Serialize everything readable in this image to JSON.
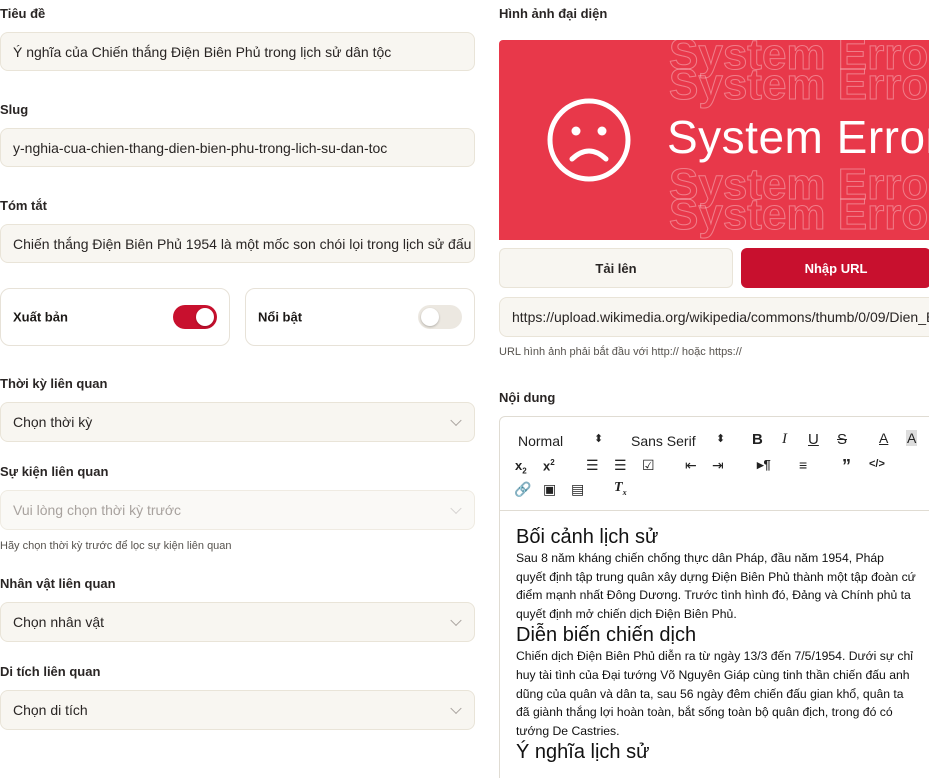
{
  "form": {
    "title_label": "Tiêu đề",
    "title_value": "Ý nghĩa của Chiến thắng Điện Biên Phủ trong lịch sử dân tộc",
    "slug_label": "Slug",
    "slug_value": "y-nghia-cua-chien-thang-dien-bien-phu-trong-lich-su-dan-toc",
    "summary_label": "Tóm tắt",
    "summary_value": "Chiến thắng Điện Biên Phủ 1954 là một mốc son chói lọi trong lịch sử đấu tranh",
    "publish_label": "Xuất bản",
    "publish_on": true,
    "featured_label": "Nổi bật",
    "featured_on": false,
    "period_label": "Thời kỳ liên quan",
    "period_placeholder": "Chọn thời kỳ",
    "event_label": "Sự kiện liên quan",
    "event_placeholder": "Vui lòng chọn thời kỳ trước",
    "event_hint": "Hãy chọn thời kỳ trước để lọc sự kiện liên quan",
    "person_label": "Nhân vật liên quan",
    "person_placeholder": "Chọn nhân vật",
    "relic_label": "Di tích liên quan",
    "relic_placeholder": "Chọn di tích"
  },
  "image": {
    "label": "Hình ảnh đại diện",
    "preview_text": "System Error",
    "upload_label": "Tải lên",
    "url_label": "Nhập URL",
    "url_value": "https://upload.wikimedia.org/wikipedia/commons/thumb/0/09/Dien_Bien_Phu",
    "url_hint": "URL hình ảnh phải bắt đầu với http:// hoặc https://"
  },
  "editor": {
    "label": "Nội dung",
    "format_select": "Normal",
    "font_select": "Sans Serif",
    "content": [
      {
        "type": "h2",
        "text": "Bối cảnh lịch sử"
      },
      {
        "type": "p",
        "text": "Sau 8 năm kháng chiến chống thực dân Pháp, đầu năm 1954, Pháp quyết định tập trung quân xây dựng Điện Biên Phủ thành một tập đoàn cứ điểm mạnh nhất Đông Dương. Trước tình hình đó, Đảng và Chính phủ ta quyết định mở chiến dịch Điện Biên Phủ."
      },
      {
        "type": "h2",
        "text": "Diễn biến chiến dịch"
      },
      {
        "type": "p",
        "text": "Chiến dịch Điện Biên Phủ diễn ra từ ngày 13/3 đến 7/5/1954. Dưới sự chỉ huy tài tình của Đại tướng Võ Nguyên Giáp cùng tinh thần chiến đấu anh dũng của quân và dân ta, sau 56 ngày đêm chiến đấu gian khổ, quân ta đã giành thắng lợi hoàn toàn, bắt sống toàn bộ quân địch, trong đó có tướng De Castries."
      },
      {
        "type": "h2",
        "text": "Ý nghĩa lịch sử"
      }
    ]
  },
  "colors": {
    "accent": "#c8102e",
    "error_banner": "#e8384a",
    "field_bg": "#f8f6f1"
  }
}
